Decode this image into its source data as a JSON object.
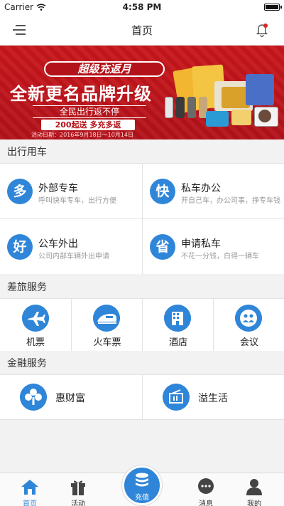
{
  "status_bar": {
    "carrier": "Carrier",
    "time": "4:58 PM"
  },
  "nav": {
    "title": "首页"
  },
  "banner": {
    "pill": "超级充返月",
    "headline": "全新更名品牌升级",
    "sub": "全民出行返不停",
    "promo": "200起送 多充多返",
    "dates": "活动日期：2016年9月18日～10月14日"
  },
  "sections": {
    "travel_car": "出行用车",
    "business_travel": "差旅服务",
    "finance": "金融服务"
  },
  "car_services": [
    {
      "icon_char": "多",
      "title": "外部专车",
      "desc": "呼叫快车专车，出行方便"
    },
    {
      "icon_char": "快",
      "title": "私车办公",
      "desc": "开自己车，办公司事，挣专车钱"
    },
    {
      "icon_char": "好",
      "title": "公车外出",
      "desc": "公司内部车辆外出申请"
    },
    {
      "icon_char": "省",
      "title": "申请私车",
      "desc": "不花一分钱，白得一辆车"
    }
  ],
  "travel_services": [
    {
      "icon": "airplane-icon",
      "label": "机票"
    },
    {
      "icon": "train-icon",
      "label": "火车票"
    },
    {
      "icon": "hotel-icon",
      "label": "酒店"
    },
    {
      "icon": "meeting-icon",
      "label": "会议"
    }
  ],
  "finance_services": [
    {
      "icon": "clover-icon",
      "label": "惠财富"
    },
    {
      "icon": "wallet-icon",
      "label": "溢生活"
    }
  ],
  "tabbar": {
    "home": "首页",
    "activity": "活动",
    "recharge": "充值",
    "messages": "消息",
    "mine": "我的"
  },
  "colors": {
    "accent": "#2f86d8",
    "banner_red": "#c9171c"
  }
}
